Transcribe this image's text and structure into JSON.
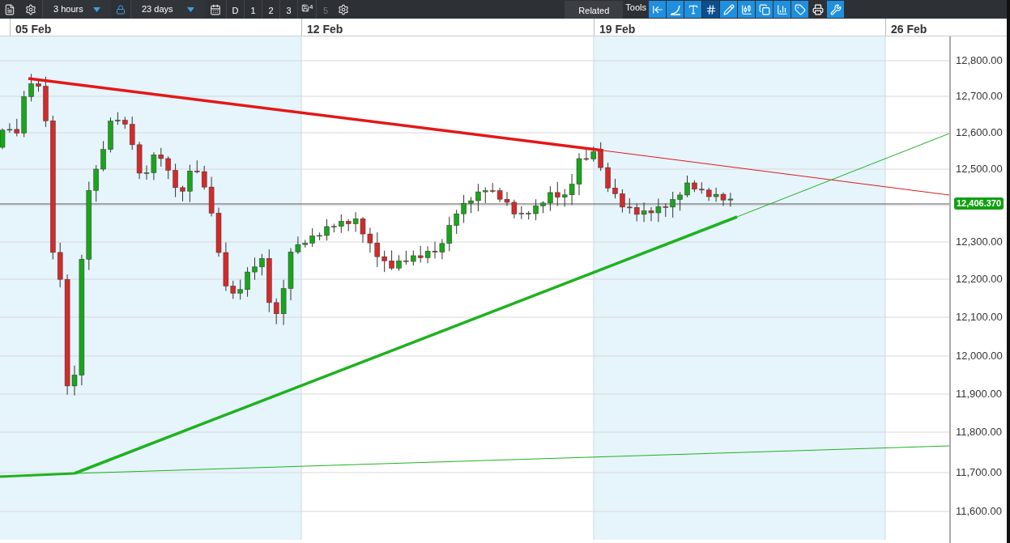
{
  "toolbar": {
    "interval": "3 hours",
    "range": "23 days",
    "presets": [
      {
        "label": "D",
        "kind": "text",
        "disabled": false
      },
      {
        "label": "1",
        "kind": "text",
        "disabled": false
      },
      {
        "label": "2",
        "kind": "text",
        "disabled": false
      },
      {
        "label": "3",
        "kind": "text",
        "disabled": false
      },
      {
        "label": "4",
        "kind": "slot",
        "disabled": false
      },
      {
        "label": "5",
        "kind": "text",
        "disabled": true
      }
    ],
    "related": "Related",
    "tools_label": "Tools",
    "tools": [
      {
        "kind": "exit",
        "selected": false
      },
      {
        "kind": "curve",
        "selected": false
      },
      {
        "kind": "text",
        "selected": false
      },
      {
        "kind": "grid",
        "selected": true
      },
      {
        "kind": "draw",
        "selected": false
      },
      {
        "kind": "candle",
        "selected": false
      },
      {
        "kind": "windows",
        "selected": false
      },
      {
        "kind": "studies",
        "selected": false
      },
      {
        "kind": "label",
        "selected": false
      },
      {
        "kind": "print",
        "selected": false
      },
      {
        "kind": "settings",
        "selected": false
      }
    ]
  },
  "dates": [
    "05 Feb",
    "12 Feb",
    "19 Feb",
    "26 Feb"
  ],
  "price_axis": [
    "12,800.00",
    "12,700.00",
    "12,600.00",
    "12,500.00",
    "12,300.00",
    "12,200.00",
    "12,100.00",
    "12,000.00",
    "11,900.00",
    "11,800.00",
    "11,700.00",
    "11,600.00"
  ],
  "price_tag": "12,406.370"
}
